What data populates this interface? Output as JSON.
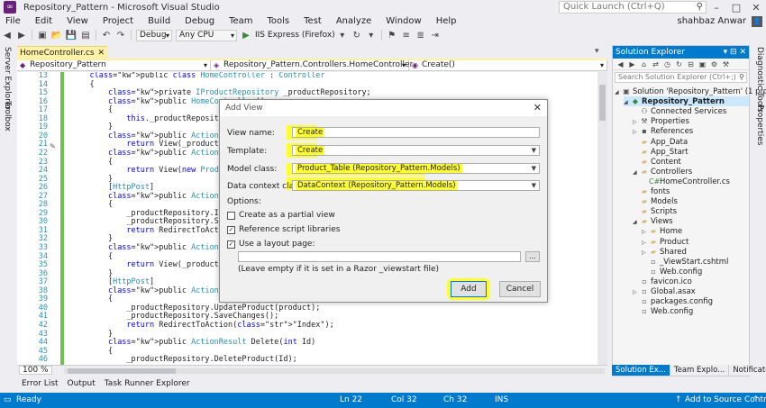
{
  "window": {
    "title": "Repository_Pattern - Microsoft Visual Studio",
    "quick_launch_placeholder": "Quick Launch (Ctrl+Q)",
    "user": "shahbaz Anwar"
  },
  "menu": [
    "File",
    "Edit",
    "View",
    "Project",
    "Build",
    "Debug",
    "Team",
    "Tools",
    "Test",
    "Analyze",
    "Window",
    "Help"
  ],
  "toolbar": {
    "config": "Debug",
    "platform": "Any CPU",
    "run_target": "IIS Express (Firefox)"
  },
  "left_tabs": [
    "Server Explorer",
    "Toolbox"
  ],
  "right_tabs": [
    "Diagnostic Tools",
    "Properties"
  ],
  "editor": {
    "tab": "HomeController.cs",
    "nav_project": "Repository_Pattern",
    "nav_class": "Repository_Pattern.Controllers.HomeController",
    "nav_member": "Create()",
    "zoom": "100 %",
    "lines": [
      {
        "n": "13",
        "code": "    public class HomeController : Controller"
      },
      {
        "n": "14",
        "code": "    {"
      },
      {
        "n": "15",
        "code": "        private IProductRepository _productRepository;"
      },
      {
        "n": "16",
        "code": "        public HomeController()"
      },
      {
        "n": "17",
        "code": "        {"
      },
      {
        "n": "18",
        "code": "            this._productRepository = ("
      },
      {
        "n": "19",
        "code": "        }"
      },
      {
        "n": "20",
        "code": "        public ActionResult Index()"
      },
      {
        "n": "21",
        "code": "            return View(_productRe"
      },
      {
        "n": "22",
        "code": "        public ActionResult Create()"
      },
      {
        "n": "23",
        "code": "        {"
      },
      {
        "n": "24",
        "code": "            return View(new Product_Tab"
      },
      {
        "n": "25",
        "code": "        }"
      },
      {
        "n": "26",
        "code": "        [HttpPost]"
      },
      {
        "n": "27",
        "code": "        public ActionResult Create(Prod"
      },
      {
        "n": "28",
        "code": "        {"
      },
      {
        "n": "29",
        "code": "            _productRepository.InsertP"
      },
      {
        "n": "30",
        "code": "            _productRepository.SaveChan"
      },
      {
        "n": "31",
        "code": "            return RedirectToAction(\"In"
      },
      {
        "n": "32",
        "code": "        }"
      },
      {
        "n": "33",
        "code": "        public ActionResult Update(int"
      },
      {
        "n": "34",
        "code": "        {"
      },
      {
        "n": "35",
        "code": "            return View(_productReposi"
      },
      {
        "n": "36",
        "code": "        }"
      },
      {
        "n": "37",
        "code": "        [HttpPost]"
      },
      {
        "n": "38",
        "code": "        public ActionResult Update(Prod"
      },
      {
        "n": "39",
        "code": "        {"
      },
      {
        "n": "40",
        "code": "            _productRepository.UpdateProduct(product);"
      },
      {
        "n": "41",
        "code": "            _productRepository.SaveChanges();"
      },
      {
        "n": "42",
        "code": "            return RedirectToAction(\"Index\");"
      },
      {
        "n": "43",
        "code": "        }"
      },
      {
        "n": "44",
        "code": "        public ActionResult Delete(int Id)"
      },
      {
        "n": "45",
        "code": "        {"
      },
      {
        "n": "46",
        "code": "            _productRepository.DeleteProduct(Id);"
      }
    ]
  },
  "dialog": {
    "title": "Add View",
    "view_name_label": "View name:",
    "view_name": "Create",
    "template_label": "Template:",
    "template": "Create",
    "model_class_label": "Model class:",
    "model_class": "Product_Table (Repository_Pattern.Models)",
    "data_context_label": "Data context class:",
    "data_context": "DataContext (Repository_Pattern.Models)",
    "options_label": "Options:",
    "opt_partial": "Create as a partial view",
    "opt_scripts": "Reference script libraries",
    "opt_layout": "Use a layout page:",
    "layout_hint": "(Leave empty if it is set in a Razor _viewstart file)",
    "browse": "...",
    "add": "Add",
    "cancel": "Cancel"
  },
  "solution_explorer": {
    "title": "Solution Explorer",
    "search_placeholder": "Search Solution Explorer (Ctrl+;)",
    "items": [
      {
        "label": "Solution 'Repository_Pattern' (1 project)",
        "indent": 0,
        "icon": "solution"
      },
      {
        "label": "Repository_Pattern",
        "indent": 1,
        "icon": "project",
        "bold": true,
        "selected": true
      },
      {
        "label": "Connected Services",
        "indent": 2,
        "icon": "services"
      },
      {
        "label": "Properties",
        "indent": 2,
        "icon": "wrench"
      },
      {
        "label": "References",
        "indent": 2,
        "icon": "references"
      },
      {
        "label": "App_Data",
        "indent": 2,
        "icon": "folder"
      },
      {
        "label": "App_Start",
        "indent": 2,
        "icon": "folder"
      },
      {
        "label": "Content",
        "indent": 2,
        "icon": "folder"
      },
      {
        "label": "Controllers",
        "indent": 2,
        "icon": "folder",
        "expanded": true
      },
      {
        "label": "HomeController.cs",
        "indent": 3,
        "icon": "cs"
      },
      {
        "label": "fonts",
        "indent": 2,
        "icon": "folder"
      },
      {
        "label": "Models",
        "indent": 2,
        "icon": "folder"
      },
      {
        "label": "Scripts",
        "indent": 2,
        "icon": "folder"
      },
      {
        "label": "Views",
        "indent": 2,
        "icon": "folder",
        "expanded": true
      },
      {
        "label": "Home",
        "indent": 3,
        "icon": "folder"
      },
      {
        "label": "Product",
        "indent": 3,
        "icon": "folder"
      },
      {
        "label": "Shared",
        "indent": 3,
        "icon": "folder"
      },
      {
        "label": "_ViewStart.cshtml",
        "indent": 3,
        "icon": "file"
      },
      {
        "label": "Web.config",
        "indent": 3,
        "icon": "file"
      },
      {
        "label": "favicon.ico",
        "indent": 2,
        "icon": "file"
      },
      {
        "label": "Global.asax",
        "indent": 2,
        "icon": "file"
      },
      {
        "label": "packages.config",
        "indent": 2,
        "icon": "file"
      },
      {
        "label": "Web.config",
        "indent": 2,
        "icon": "file"
      }
    ],
    "tabs": [
      "Solution Ex...",
      "Team Explo...",
      "Notifications"
    ]
  },
  "bottom_tabs": [
    "Error List",
    "Output",
    "Task Runner Explorer"
  ],
  "status": {
    "ready": "Ready",
    "ln": "Ln 22",
    "col": "Col 32",
    "ch": "Ch 32",
    "ins": "INS",
    "source_control": "Add to Source Control"
  },
  "colors": {
    "accent": "#007acc",
    "highlight": "#ffff33",
    "tab_active": "#fff1a8"
  }
}
